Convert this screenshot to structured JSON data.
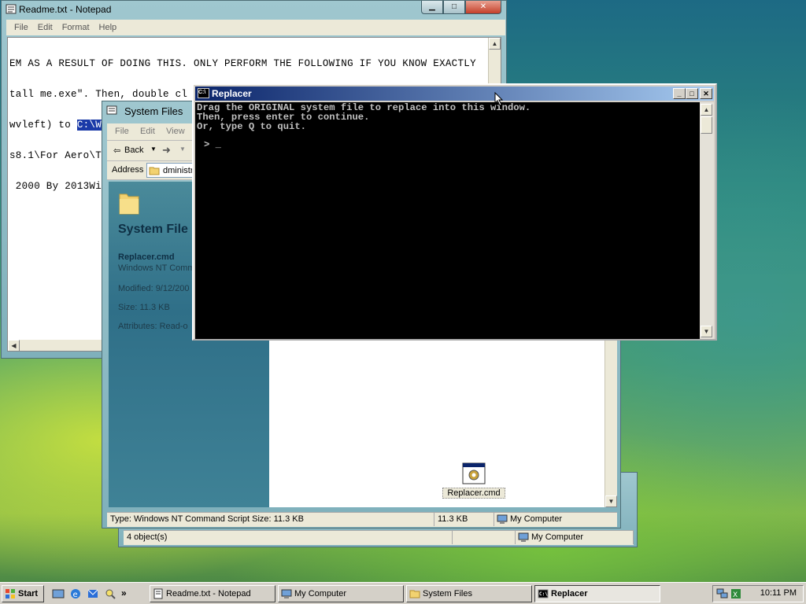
{
  "notepad": {
    "title": "Readme.txt - Notepad",
    "menu": [
      "File",
      "Edit",
      "Format",
      "Help"
    ],
    "lines": [
      "EM AS A RESULT OF DOING THIS. ONLY PERFORM THE FOLLOWING IF YOU KNOW EXACTLY",
      "tall me.exe\". Then, double cl",
      "wvleft) to ",
      "s8.1\\For Aero\\Tr",
      " 2000 By 2013Wi"
    ],
    "highlight": "C:\\W"
  },
  "explorer_back": {
    "status_objects": "4 object(s)",
    "status_location": "My Computer"
  },
  "explorer": {
    "title": "System Files",
    "menu": [
      "File",
      "Edit",
      "View"
    ],
    "back_label": "Back",
    "address_label": "Address",
    "address_value": "dministr",
    "pane_title": "System File",
    "file_name": "Replacer.cmd",
    "file_type": "Windows NT Comma",
    "modified": "Modified: 9/12/200",
    "size": "Size: 11.3 KB",
    "attributes": "Attributes: Read-o",
    "icon_label": "Replacer.cmd",
    "status_type": "Type: Windows NT Command Script Size: 11.3 KB",
    "status_size": "11.3 KB",
    "status_location": "My Computer"
  },
  "cmd": {
    "title": "Replacer",
    "icon_text": "C:\\",
    "lines": [
      "Drag the ORIGINAL system file to replace into this window.",
      "Then, press enter to continue.",
      "Or, type Q to quit."
    ],
    "prompt": "> _"
  },
  "taskbar": {
    "start_label": "Start",
    "quicklaunch_more": "»",
    "buttons": [
      "Readme.txt - Notepad",
      "My Computer",
      "System Files",
      "Replacer"
    ],
    "clock": "10:11 PM"
  },
  "colors": {
    "cmd_title": "#0a246a",
    "selection": "#1a3aa8"
  }
}
